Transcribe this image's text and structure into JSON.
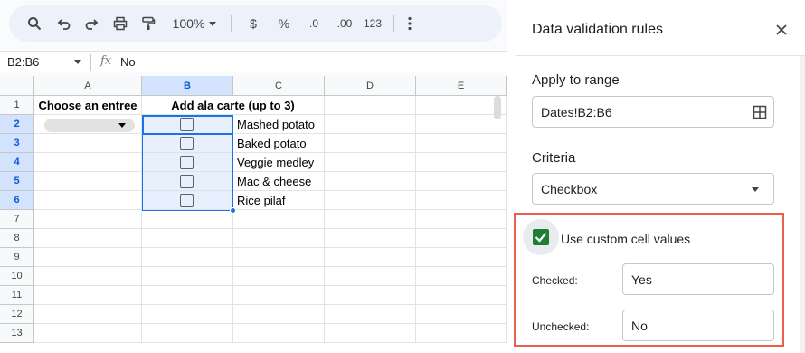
{
  "toolbar": {
    "zoom": "100%",
    "currency": "$",
    "percent": "%",
    "dec_decrease": ".0",
    "dec_increase": ".00",
    "format_123": "123"
  },
  "formula_bar": {
    "name_box": "B2:B6",
    "fx": "fx",
    "value": "No"
  },
  "columns": [
    "A",
    "B",
    "C",
    "D",
    "E"
  ],
  "rows": [
    "1",
    "2",
    "3",
    "4",
    "5",
    "6",
    "7",
    "8",
    "9",
    "10",
    "11",
    "12",
    "13"
  ],
  "cells": {
    "A1": "Choose an entree",
    "B1": "Add ala carte (up to 3)",
    "C2": "Mashed potato",
    "C3": "Baked potato",
    "C4": "Veggie medley",
    "C5": "Mac & cheese",
    "C6": "Rice pilaf"
  },
  "panel": {
    "title": "Data validation rules",
    "apply_to_range_label": "Apply to range",
    "range_value": "Dates!B2:B6",
    "criteria_label": "Criteria",
    "criteria_value": "Checkbox",
    "custom_values_label": "Use custom cell values",
    "custom_values_checked": true,
    "checked_label": "Checked:",
    "checked_value": "Yes",
    "unchecked_label": "Unchecked:",
    "unchecked_value": "No"
  },
  "colors": {
    "selection": "#1a73e8",
    "highlight_box": "#e8604c",
    "checkbox_green": "#1e7e34"
  }
}
